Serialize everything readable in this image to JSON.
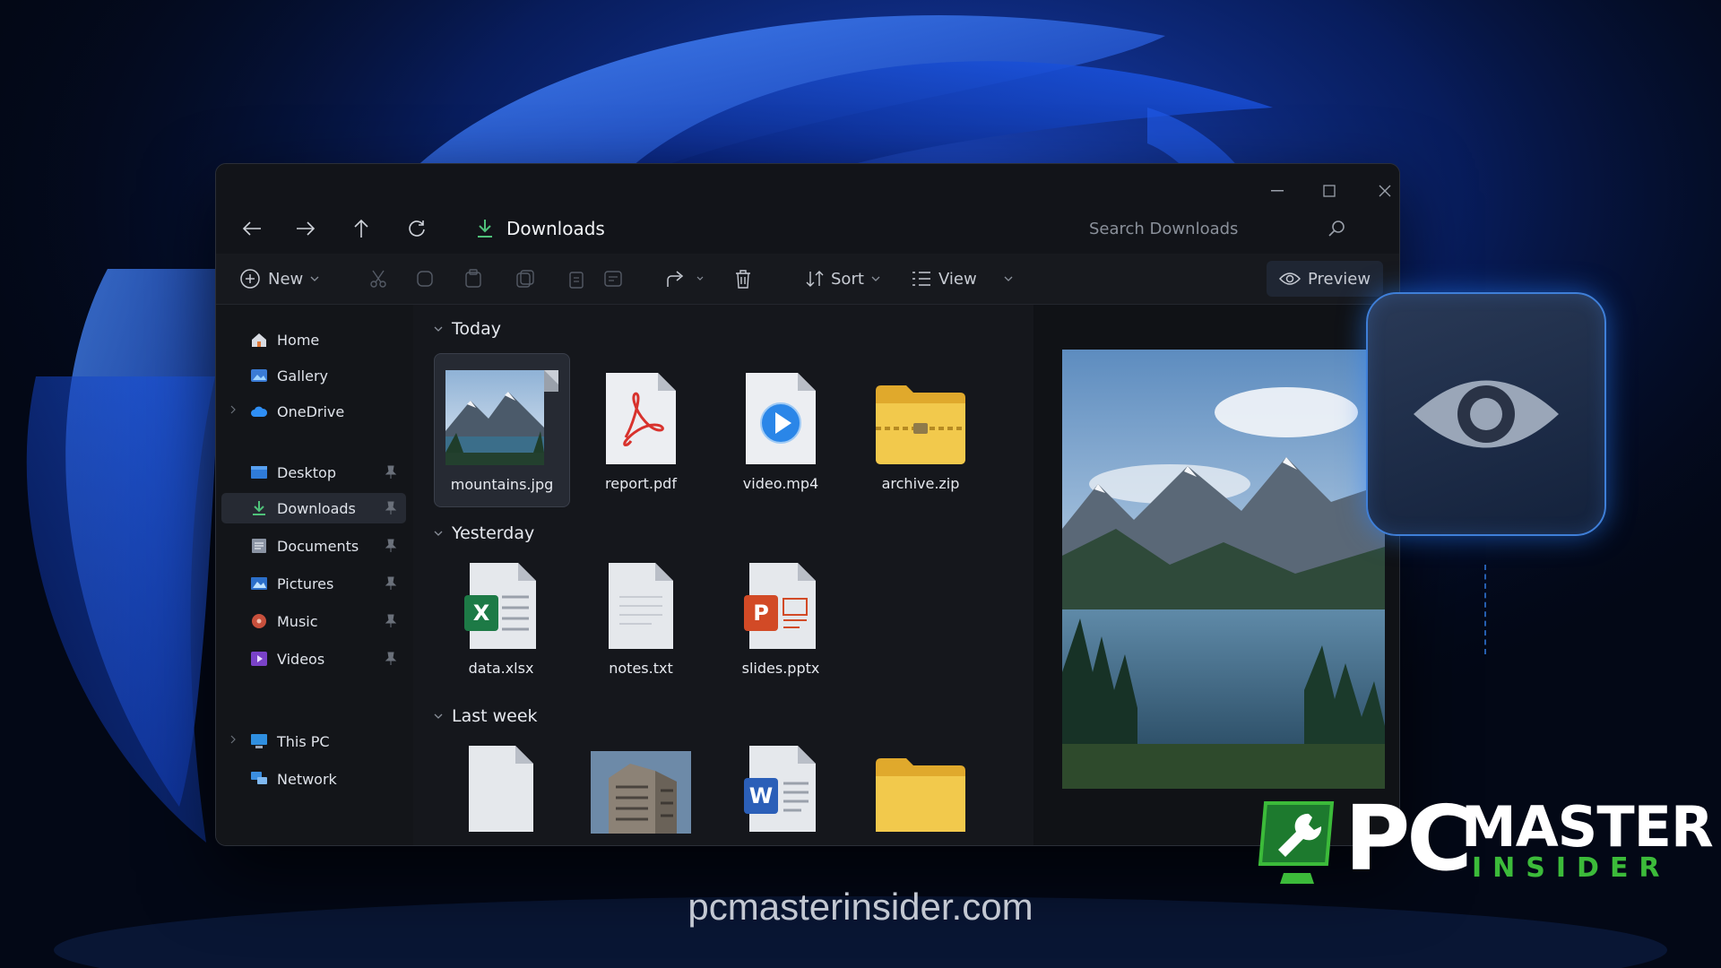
{
  "window": {
    "location": "Downloads",
    "search_placeholder": "Search Downloads"
  },
  "toolbar": {
    "new_label": "New",
    "sort_label": "Sort",
    "view_label": "View",
    "preview_label": "Preview"
  },
  "sidebar": {
    "items": [
      {
        "label": "Home",
        "icon": "home-icon"
      },
      {
        "label": "Gallery",
        "icon": "gallery-icon"
      },
      {
        "label": "OneDrive",
        "icon": "cloud-icon"
      },
      {
        "label": "Desktop",
        "icon": "desktop-icon",
        "pinned": true
      },
      {
        "label": "Downloads",
        "icon": "download-icon",
        "pinned": true,
        "selected": true
      },
      {
        "label": "Documents",
        "icon": "documents-icon",
        "pinned": true
      },
      {
        "label": "Pictures",
        "icon": "pictures-icon",
        "pinned": true
      },
      {
        "label": "Music",
        "icon": "music-icon",
        "pinned": true
      },
      {
        "label": "Videos",
        "icon": "videos-icon",
        "pinned": true
      },
      {
        "label": "This PC",
        "icon": "pc-icon"
      },
      {
        "label": "Network",
        "icon": "network-icon"
      }
    ]
  },
  "groups": [
    {
      "label": "Today",
      "files": [
        {
          "name": "mountains.jpg",
          "icon": "image-thumbnail",
          "selected": true
        },
        {
          "name": "report.pdf",
          "icon": "pdf-icon"
        },
        {
          "name": "video.mp4",
          "icon": "video-file-icon"
        },
        {
          "name": "archive.zip",
          "icon": "zip-folder-icon"
        }
      ]
    },
    {
      "label": "Yesterday",
      "files": [
        {
          "name": "data.xlsx",
          "icon": "excel-icon"
        },
        {
          "name": "notes.txt",
          "icon": "text-file-icon"
        },
        {
          "name": "slides.pptx",
          "icon": "powerpoint-icon"
        }
      ]
    },
    {
      "label": "Last week",
      "files": [
        {
          "name": "",
          "icon": "blank-file-icon"
        },
        {
          "name": "",
          "icon": "building-thumbnail"
        },
        {
          "name": "",
          "icon": "word-icon"
        },
        {
          "name": "",
          "icon": "folder-icon"
        }
      ]
    }
  ],
  "brand": {
    "pc": "PC",
    "master": "MASTER",
    "insider": "INSIDER",
    "website": "pcmasterinsider.com"
  },
  "colors": {
    "accent_blue": "#2f7bff",
    "download_green": "#4fc27a",
    "brand_green": "#3cbb3a",
    "folder_yellow": "#f2c94c"
  }
}
